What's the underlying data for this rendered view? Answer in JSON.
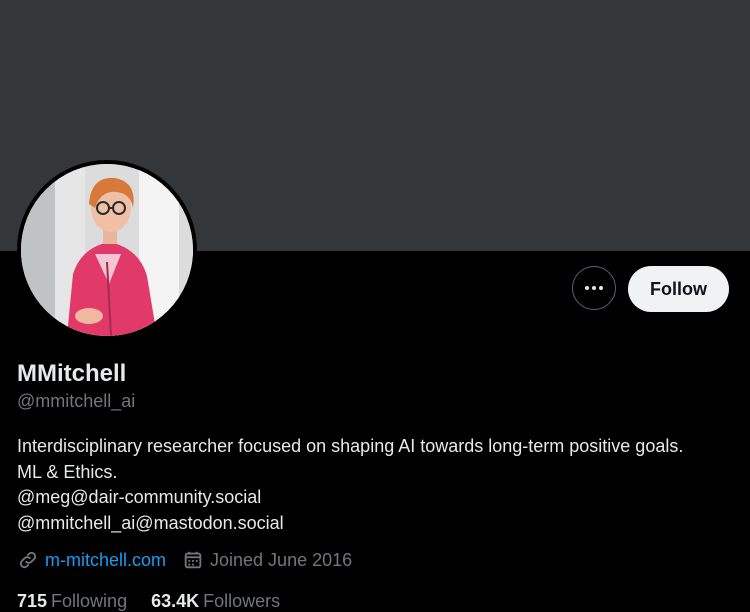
{
  "profile": {
    "name": "MMitchell",
    "handle": "@mmitchell_ai",
    "bio_lines": [
      "Interdisciplinary researcher focused on shaping AI towards long-term positive goals.",
      "ML & Ethics.",
      "@meg@dair-community.social",
      "@mmitchell_ai@mastodon.social"
    ],
    "website": "m-mitchell.com",
    "joined": "Joined June 2016"
  },
  "actions": {
    "follow_label": "Follow",
    "more_icon": "more-dots-icon"
  },
  "stats": {
    "following_count": "715",
    "following_label": "Following",
    "followers_count": "63.4K",
    "followers_label": "Followers"
  },
  "colors": {
    "background": "#000000",
    "banner": "#33373a",
    "link": "#1d9bf0",
    "secondary_text": "#71767b",
    "primary_text": "#e7e9ea",
    "follow_button": "#eff3f4"
  }
}
